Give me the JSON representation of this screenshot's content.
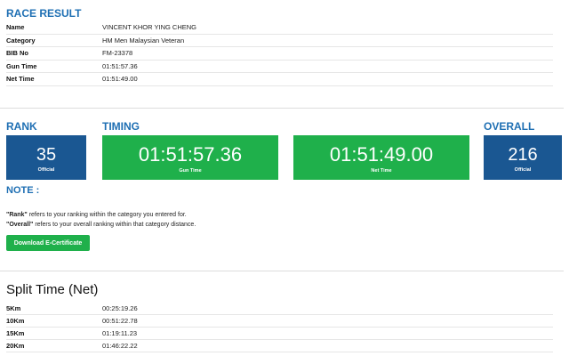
{
  "race_result": {
    "title": "RACE RESULT",
    "rows": [
      {
        "label": "Name",
        "value": "VINCENT KHOR YING CHENG"
      },
      {
        "label": "Category",
        "value": "HM Men Malaysian Veteran"
      },
      {
        "label": "BIB No",
        "value": "FM-23378"
      },
      {
        "label": "Gun Time",
        "value": "01:51:57.36"
      },
      {
        "label": "Net Time",
        "value": "01:51:49.00"
      }
    ]
  },
  "rank": {
    "title": "RANK",
    "value": "35",
    "sub": "Official"
  },
  "timing": {
    "title": "TIMING",
    "gun": {
      "value": "01:51:57.36",
      "sub": "Gun Time"
    },
    "net": {
      "value": "01:51:49.00",
      "sub": "Net Time"
    }
  },
  "overall": {
    "title": "OVERALL",
    "value": "216",
    "sub": "Official"
  },
  "note": {
    "title": "NOTE :",
    "rank_term": "\"Rank\"",
    "rank_text": " refers to your ranking within the category you entered for.",
    "overall_term": "\"Overall\"",
    "overall_text": " refers to your overall ranking within that category distance."
  },
  "certificate_button": "Download E-Certificate",
  "split": {
    "title": "Split Time (Net)",
    "rows": [
      {
        "label": "5Km",
        "value": "00:25:19.26"
      },
      {
        "label": "10Km",
        "value": "00:51:22.78"
      },
      {
        "label": "15Km",
        "value": "01:19:11.23"
      },
      {
        "label": "20Km",
        "value": "01:46:22.22"
      }
    ]
  },
  "colors": {
    "accent_blue": "#1e6fb3",
    "rank_blue": "#1a5792",
    "timing_green": "#1fb04b"
  }
}
